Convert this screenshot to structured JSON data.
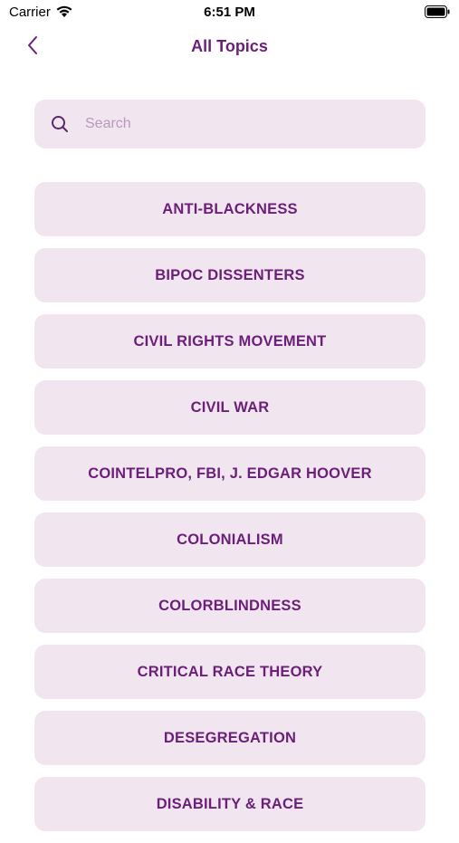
{
  "status_bar": {
    "carrier": "Carrier",
    "time": "6:51 PM",
    "icons": [
      "wifi-icon",
      "battery-icon"
    ]
  },
  "nav": {
    "title": "All Topics",
    "back_icon": "chevron-left-icon"
  },
  "search": {
    "placeholder": "Search",
    "value": "",
    "icon": "search-icon"
  },
  "topics": [
    {
      "label": "ANTI-BLACKNESS"
    },
    {
      "label": "BIPOC DISSENTERS"
    },
    {
      "label": "CIVIL RIGHTS MOVEMENT"
    },
    {
      "label": "CIVIL WAR"
    },
    {
      "label": "COINTELPRO, FBI, J. EDGAR HOOVER"
    },
    {
      "label": "COLONIALISM"
    },
    {
      "label": "COLORBLINDNESS"
    },
    {
      "label": "CRITICAL RACE THEORY"
    },
    {
      "label": "DESEGREGATION"
    },
    {
      "label": "DISABILITY & RACE"
    }
  ],
  "colors": {
    "accent": "#6b1f78",
    "tile_background": "#f1e6ef",
    "placeholder": "#b79ab8"
  }
}
